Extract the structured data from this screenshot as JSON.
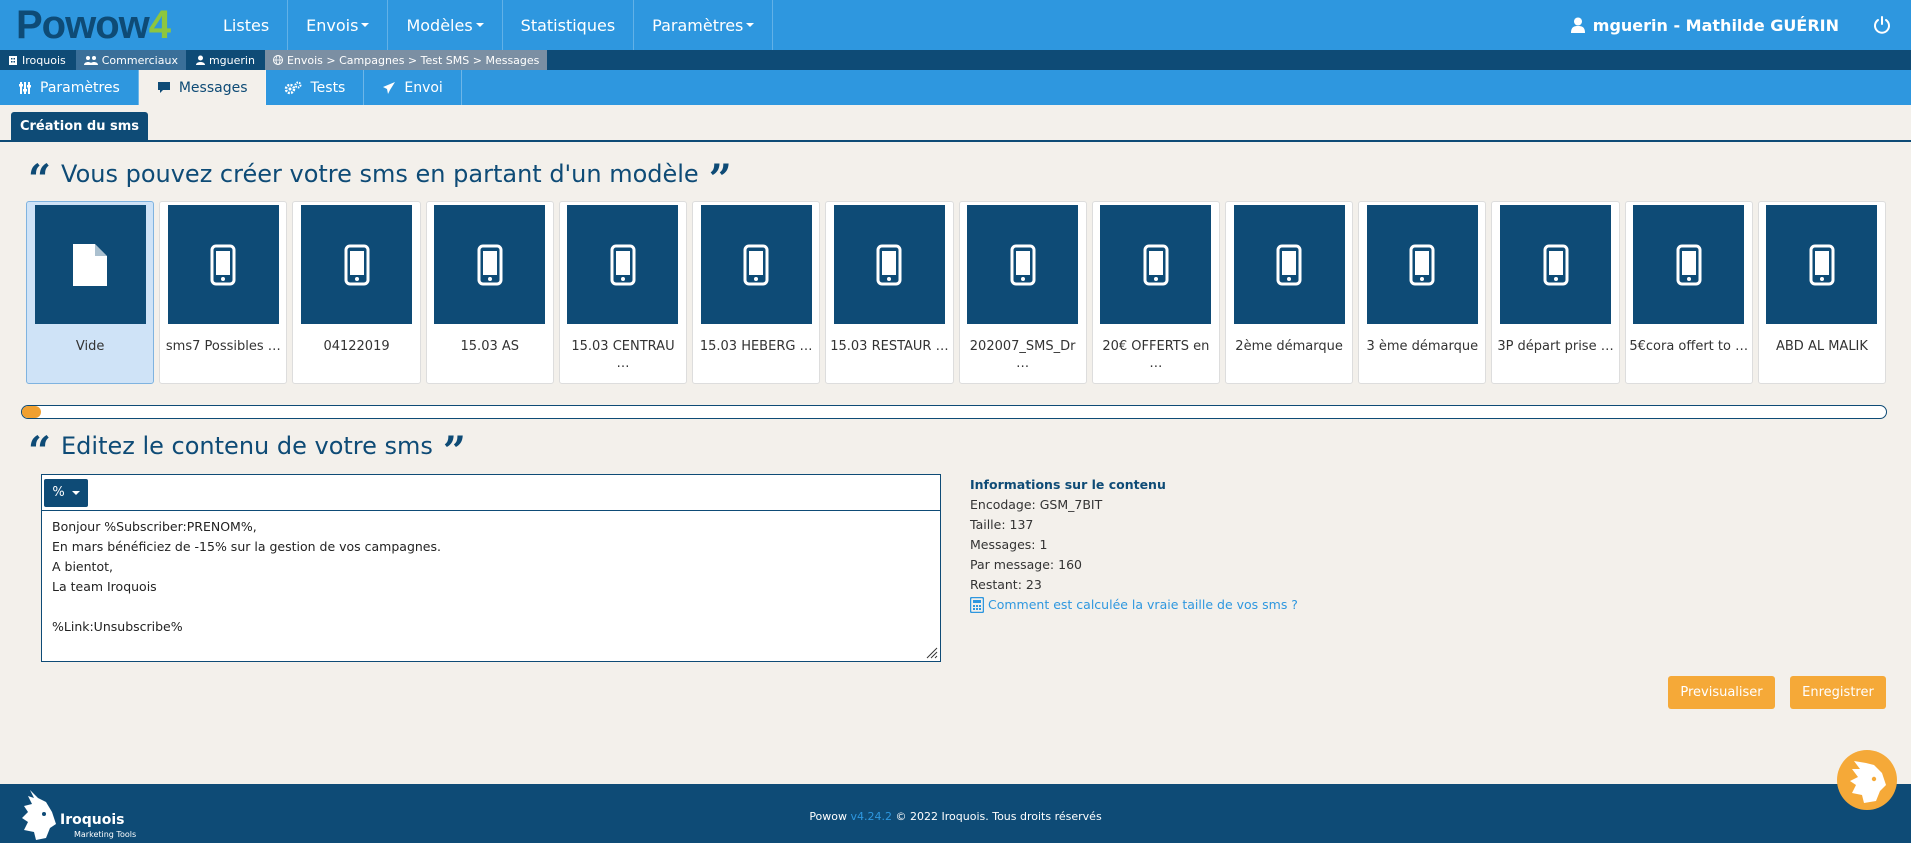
{
  "brand": {
    "logo_main": "Powow",
    "logo_suffix": "4"
  },
  "nav": {
    "items": [
      {
        "label": "Listes",
        "dropdown": false
      },
      {
        "label": "Envois",
        "dropdown": true
      },
      {
        "label": "Modèles",
        "dropdown": true
      },
      {
        "label": "Statistiques",
        "dropdown": false
      },
      {
        "label": "Paramètres",
        "dropdown": true
      }
    ],
    "user": "mguerin - Mathilde GUÉRIN"
  },
  "breadcrumb": {
    "items": [
      "Iroquois",
      "Commerciaux",
      "mguerin",
      "Envois > Campagnes > Test SMS > Messages"
    ]
  },
  "tabs": {
    "items": [
      "Paramètres",
      "Messages",
      "Tests",
      "Envoi"
    ],
    "active": "Messages"
  },
  "section": {
    "label": "Création du sms"
  },
  "templates": {
    "heading": "Vous pouvez créer votre sms en partant d'un modèle",
    "items": [
      "Vide",
      "sms7 Possibles …",
      "04122019",
      "15.03 AS",
      "15.03 CENTRAU …",
      "15.03 HEBERG …",
      "15.03 RESTAUR …",
      "202007_SMS_Dr …",
      "20€ OFFERTS en …",
      "2ème démarque",
      "3 ème démarque",
      "3P départ prise …",
      "5€cora offert to …",
      "ABD AL MALIK"
    ],
    "selected": "Vide",
    "progress": 0.01
  },
  "editor": {
    "heading": "Editez le contenu de votre sms",
    "insert_button": "%",
    "content": "Bonjour %Subscriber:PRENOM%,\nEn mars bénéficiez de -15% sur la gestion de vos campagnes.\nA bientot,\nLa team Iroquois\n\n%Link:Unsubscribe%"
  },
  "info": {
    "title": "Informations sur le contenu",
    "encodage": "Encodage: GSM_7BIT",
    "taille": "Taille: 137",
    "messages": "Messages: 1",
    "par_message": "Par message: 160",
    "restant": "Restant: 23",
    "help_link": "Comment est calculée la vraie taille de vos sms ?"
  },
  "actions": {
    "preview": "Previsualiser",
    "save": "Enregistrer"
  },
  "footer": {
    "app": "Powow",
    "version": "v4.24.2",
    "copyright": "© 2022 Iroquois. Tous droits réservés",
    "logo_name": "Iroquois",
    "logo_tagline": "Marketing Tools"
  },
  "colors": {
    "primary": "#2e97df",
    "dark": "#0e4b76",
    "accent": "#f5a938",
    "logo_green": "#8dc63f",
    "background": "#f3f0eb"
  }
}
